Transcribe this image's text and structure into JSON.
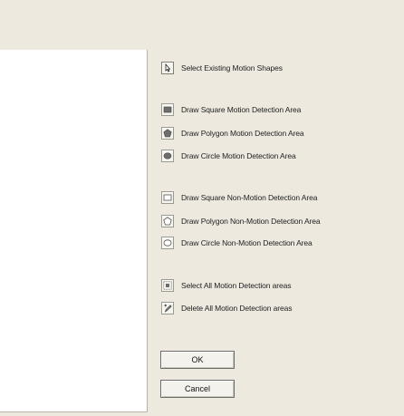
{
  "tools": {
    "select_existing": "Select Existing Motion Shapes",
    "draw_square_motion": "Draw Square Motion Detection Area",
    "draw_polygon_motion": "Draw Polygon Motion Detection Area",
    "draw_circle_motion": "Draw Circle  Motion Detection Area",
    "draw_square_nonmotion": "Draw Square Non-Motion Detection Area",
    "draw_polygon_nonmotion": "Draw Polygon Non-Motion Detection Area",
    "draw_circle_nonmotion": "Draw Circle  Non-Motion Detection Area",
    "select_all": "Select All Motion Detection areas",
    "delete_all": "Delete  All Motion Detection areas"
  },
  "buttons": {
    "ok": "OK",
    "cancel": "Cancel"
  },
  "icons": {
    "select_existing": "cursor-arrow-icon",
    "draw_square_motion": "filled-square-icon",
    "draw_polygon_motion": "filled-polygon-icon",
    "draw_circle_motion": "filled-circle-icon",
    "draw_square_nonmotion": "outline-square-icon",
    "draw_polygon_nonmotion": "outline-polygon-icon",
    "draw_circle_nonmotion": "outline-circle-icon",
    "select_all": "select-all-icon",
    "delete_all": "delete-pencil-icon"
  }
}
